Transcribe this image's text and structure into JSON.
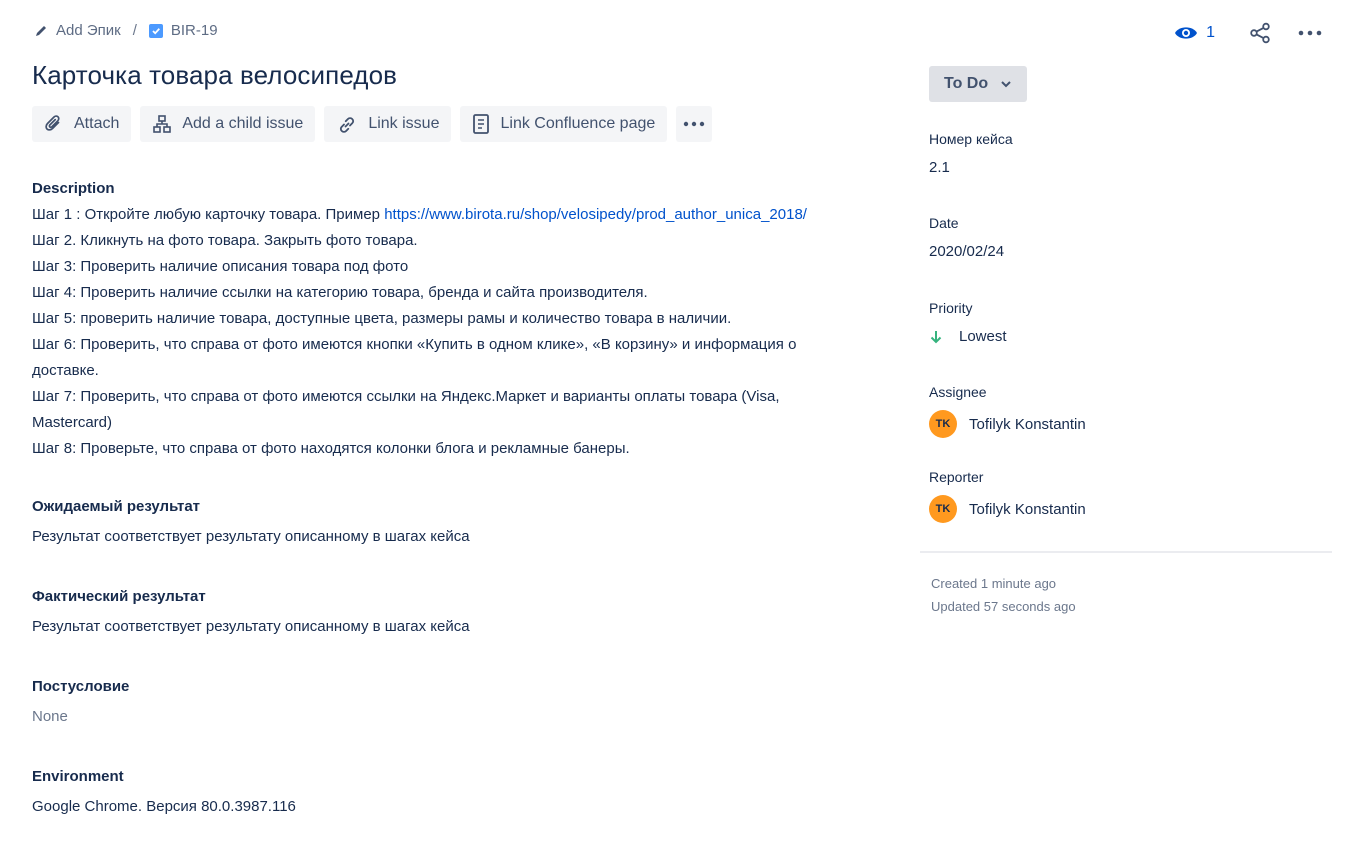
{
  "breadcrumb": {
    "epic_label": "Add Эпик",
    "separator": "/",
    "issue_key": "BIR-19"
  },
  "header": {
    "watch_count": "1",
    "title": "Карточка товара велосипедов"
  },
  "toolbar": {
    "attach_label": "Attach",
    "child_label": "Add a child issue",
    "link_label": "Link issue",
    "confluence_label": "Link Confluence page"
  },
  "description": {
    "title": "Description",
    "step1_text": "Шаг 1 : Откройте любую карточку товара. Пример ",
    "step1_link": "https://www.birota.ru/shop/velosipedy/prod_author_unica_2018/",
    "lines": [
      "Шаг 2. Кликнуть на фото товара. Закрыть фото товара.",
      "Шаг 3: Проверить наличие описания товара под фото",
      "Шаг 4: Проверить наличие ссылки на категорию товара, бренда и сайта производителя.",
      "Шаг 5: проверить наличие товара, доступные цвета, размеры рамы и количество товара в наличии.",
      "Шаг 6: Проверить, что справа от фото имеются кнопки «Купить в одном клике», «В корзину» и информация о доставке.",
      "Шаг 7: Проверить, что справа от фото имеются ссылки на Яндекс.Маркет и варианты оплаты товара (Visa, Mastercard)",
      "Шаг 8: Проверьте, что справа от фото находятся колонки блога и рекламные банеры."
    ]
  },
  "expected": {
    "title": "Ожидаемый результат",
    "value": "Результат соответствует результату описанному в шагах кейса"
  },
  "actual": {
    "title": "Фактический результат",
    "value": "Результат соответствует результату описанному в шагах кейса"
  },
  "postcondition": {
    "title": "Постусловие",
    "value": "None"
  },
  "environment": {
    "title": "Environment",
    "value": "Google Chrome. Версия 80.0.3987.116"
  },
  "sidebar": {
    "status": "To Do",
    "case_number_label": "Номер кейса",
    "case_number_value": "2.1",
    "date_label": "Date",
    "date_value": "2020/02/24",
    "priority_label": "Priority",
    "priority_value": "Lowest",
    "assignee_label": "Assignee",
    "assignee_name": "Tofilyk Konstantin",
    "assignee_initials": "TK",
    "reporter_label": "Reporter",
    "reporter_name": "Tofilyk Konstantin",
    "reporter_initials": "TK",
    "created": "Created 1 minute ago",
    "updated": "Updated 57 seconds ago"
  },
  "colors": {
    "accent": "#0052cc",
    "avatar": "#ff991f",
    "priority_lowest": "#36b37e"
  }
}
